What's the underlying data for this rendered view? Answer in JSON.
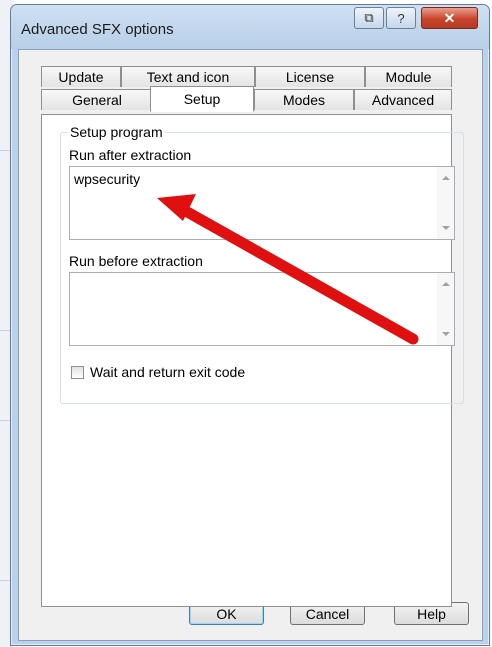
{
  "window": {
    "title": "Advanced SFX options",
    "context_btn_glyph": "⧉",
    "help_btn_glyph": "?",
    "close_btn_glyph": "✕"
  },
  "tabs": {
    "row_back": [
      "Update",
      "Text and icon",
      "License",
      "Module"
    ],
    "row_front": [
      "General",
      "Setup",
      "Modes",
      "Advanced"
    ],
    "active": "Setup"
  },
  "setup": {
    "group_title": "Setup program",
    "run_after_label": "Run after extraction",
    "run_after_value": "wpsecurity",
    "run_before_label": "Run before extraction",
    "run_before_value": "",
    "wait_checkbox_label": "Wait and return exit code",
    "wait_checked": false
  },
  "buttons": {
    "ok": "OK",
    "cancel": "Cancel",
    "help": "Help"
  },
  "colors": {
    "annotation_arrow": "#e01010",
    "close_button": "#c8452c"
  }
}
